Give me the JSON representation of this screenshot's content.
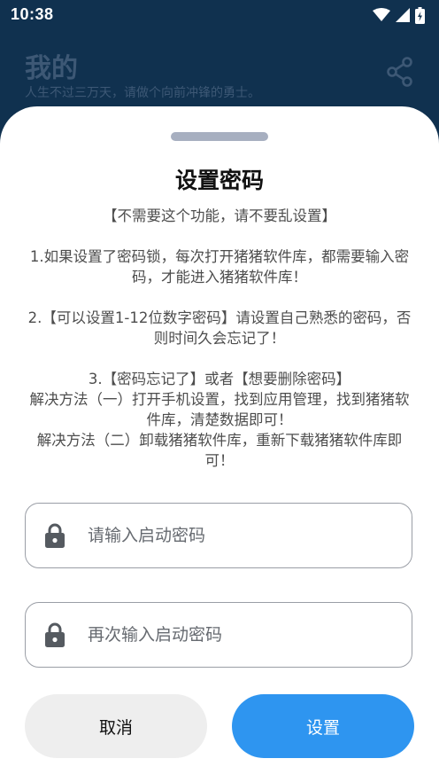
{
  "status_bar": {
    "time": "10:38",
    "icons": [
      "wifi-icon",
      "cell-signal-icon",
      "battery-charging-icon"
    ]
  },
  "app_bar": {
    "title": "我的",
    "subtitle": "人生不过三万天，请做个向前冲锋的勇士。",
    "share_icon": "share-icon"
  },
  "dialog": {
    "title": "设置密码",
    "notice": "【不需要这个功能，请不要乱设置】",
    "point1": "1.如果设置了密码锁，每次打开猪猪软件库，都需要输入密码，才能进入猪猪软件库！",
    "point2": "2.【可以设置1-12位数字密码】请设置自己熟悉的密码，否则时间久会忘记了！",
    "point3_title": "3.【密码忘记了】或者【想要删除密码】",
    "point3_solution1": "解决方法（一）打开手机设置，找到应用管理，找到猪猪软件库，清楚数据即可！",
    "point3_solution2": "解决方法（二）卸载猪猪软件库，重新下载猪猪软件库即可！",
    "password_input": {
      "placeholder": "请输入启动密码",
      "value": "",
      "icon": "lock-icon"
    },
    "confirm_input": {
      "placeholder": "再次输入启动密码",
      "value": "",
      "icon": "lock-icon"
    },
    "cancel_label": "取消",
    "confirm_label": "设置",
    "colors": {
      "primary": "#2e95f0",
      "header_bg": "#10314f",
      "cancel_bg": "#eeeeee"
    }
  }
}
